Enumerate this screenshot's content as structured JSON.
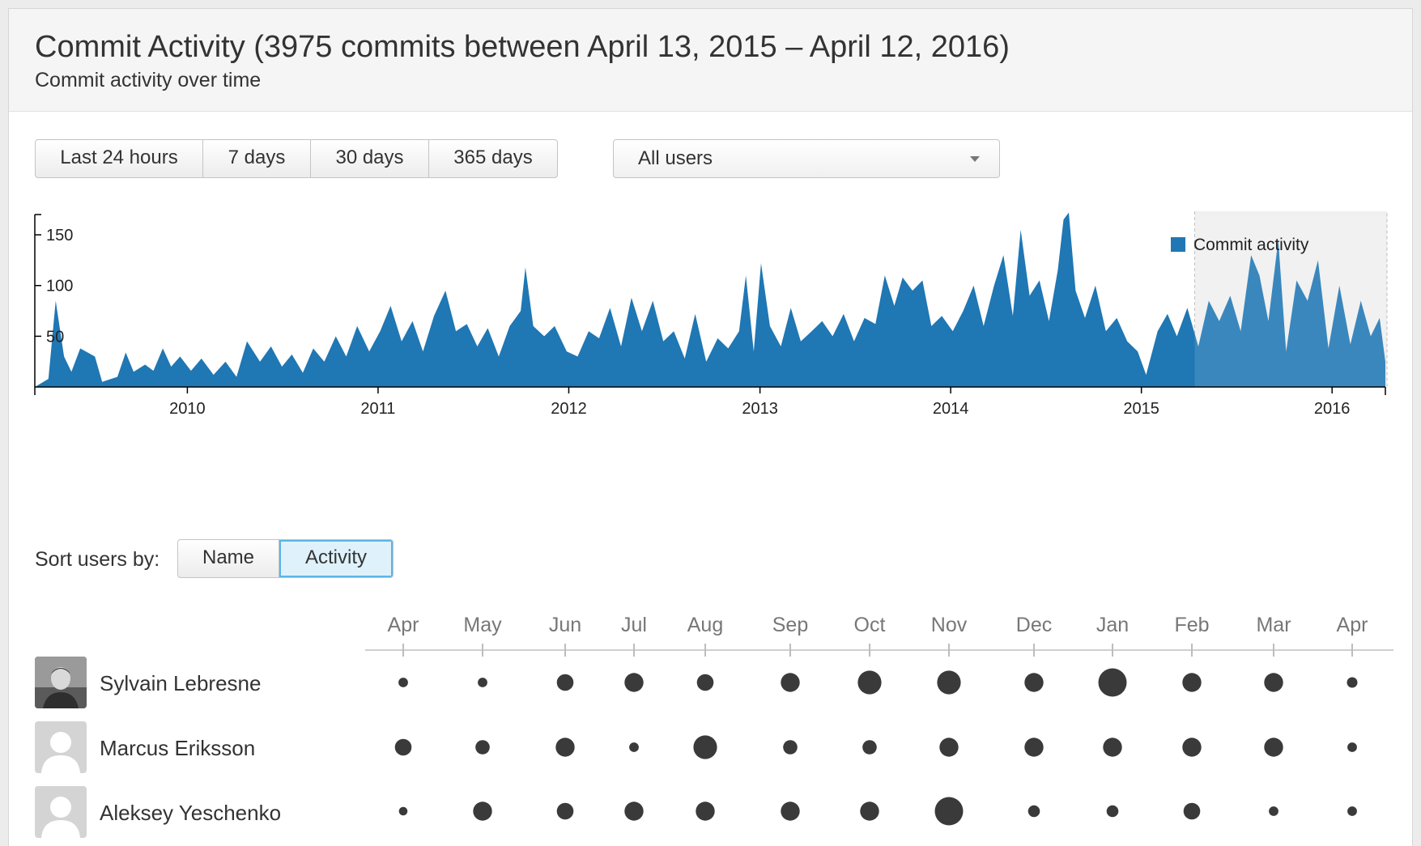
{
  "header": {
    "title": "Commit Activity (3975 commits between April 13, 2015 – April 12, 2016)",
    "subtitle": "Commit activity over time"
  },
  "range_buttons": [
    "Last 24 hours",
    "7 days",
    "30 days",
    "365 days"
  ],
  "user_filter": {
    "value": "All users"
  },
  "sort": {
    "label": "Sort users by:",
    "options": [
      "Name",
      "Activity"
    ],
    "active": "Activity"
  },
  "colors": {
    "series": "#1f77b4",
    "dot": "#3a3a3a",
    "selection": "#f0f0f0"
  },
  "chart_data": [
    {
      "type": "area",
      "title": "",
      "xlabel": "",
      "ylabel": "",
      "legend": {
        "label": "Commit activity",
        "position": "top-right"
      },
      "x_ticks": [
        "2010",
        "2011",
        "2012",
        "2013",
        "2014",
        "2015",
        "2016"
      ],
      "y_ticks": [
        50,
        100,
        150
      ],
      "xlim": [
        "2009-03-15",
        "2016-04-12"
      ],
      "ylim": [
        0,
        170
      ],
      "selection": [
        "2015-04-13",
        "2016-04-12"
      ],
      "series": [
        {
          "name": "Commit activity",
          "points": [
            [
              "2009-03-15",
              0
            ],
            [
              "2009-04-10",
              8
            ],
            [
              "2009-04-24",
              85
            ],
            [
              "2009-05-10",
              30
            ],
            [
              "2009-05-24",
              15
            ],
            [
              "2009-06-10",
              38
            ],
            [
              "2009-07-08",
              30
            ],
            [
              "2009-07-22",
              5
            ],
            [
              "2009-08-20",
              10
            ],
            [
              "2009-09-05",
              34
            ],
            [
              "2009-09-20",
              15
            ],
            [
              "2009-10-12",
              22
            ],
            [
              "2009-10-28",
              16
            ],
            [
              "2009-11-15",
              38
            ],
            [
              "2009-12-01",
              20
            ],
            [
              "2009-12-18",
              30
            ],
            [
              "2010-01-08",
              16
            ],
            [
              "2010-01-28",
              28
            ],
            [
              "2010-02-20",
              12
            ],
            [
              "2010-03-15",
              25
            ],
            [
              "2010-04-05",
              10
            ],
            [
              "2010-04-25",
              45
            ],
            [
              "2010-05-20",
              25
            ],
            [
              "2010-06-10",
              40
            ],
            [
              "2010-07-01",
              20
            ],
            [
              "2010-07-20",
              32
            ],
            [
              "2010-08-10",
              14
            ],
            [
              "2010-08-30",
              38
            ],
            [
              "2010-09-20",
              25
            ],
            [
              "2010-10-12",
              50
            ],
            [
              "2010-11-01",
              30
            ],
            [
              "2010-11-22",
              60
            ],
            [
              "2010-12-15",
              35
            ],
            [
              "2011-01-05",
              55
            ],
            [
              "2011-01-25",
              80
            ],
            [
              "2011-02-15",
              45
            ],
            [
              "2011-03-08",
              65
            ],
            [
              "2011-03-28",
              35
            ],
            [
              "2011-04-18",
              70
            ],
            [
              "2011-05-10",
              95
            ],
            [
              "2011-05-30",
              55
            ],
            [
              "2011-06-20",
              62
            ],
            [
              "2011-07-10",
              40
            ],
            [
              "2011-07-30",
              58
            ],
            [
              "2011-08-20",
              30
            ],
            [
              "2011-09-10",
              60
            ],
            [
              "2011-10-01",
              75
            ],
            [
              "2011-10-10",
              118
            ],
            [
              "2011-10-25",
              60
            ],
            [
              "2011-11-15",
              50
            ],
            [
              "2011-12-05",
              60
            ],
            [
              "2011-12-28",
              35
            ],
            [
              "2012-01-18",
              30
            ],
            [
              "2012-02-08",
              55
            ],
            [
              "2012-02-28",
              48
            ],
            [
              "2012-03-20",
              78
            ],
            [
              "2012-04-10",
              40
            ],
            [
              "2012-04-30",
              88
            ],
            [
              "2012-05-20",
              55
            ],
            [
              "2012-06-10",
              85
            ],
            [
              "2012-06-30",
              45
            ],
            [
              "2012-07-20",
              55
            ],
            [
              "2012-08-10",
              28
            ],
            [
              "2012-08-30",
              72
            ],
            [
              "2012-09-20",
              25
            ],
            [
              "2012-10-12",
              48
            ],
            [
              "2012-11-01",
              38
            ],
            [
              "2012-11-22",
              55
            ],
            [
              "2012-12-05",
              110
            ],
            [
              "2012-12-20",
              35
            ],
            [
              "2013-01-03",
              122
            ],
            [
              "2013-01-20",
              60
            ],
            [
              "2013-02-10",
              40
            ],
            [
              "2013-03-01",
              78
            ],
            [
              "2013-03-20",
              45
            ],
            [
              "2013-04-10",
              55
            ],
            [
              "2013-04-30",
              65
            ],
            [
              "2013-05-20",
              50
            ],
            [
              "2013-06-10",
              72
            ],
            [
              "2013-06-30",
              45
            ],
            [
              "2013-07-20",
              68
            ],
            [
              "2013-08-10",
              62
            ],
            [
              "2013-08-28",
              110
            ],
            [
              "2013-09-15",
              80
            ],
            [
              "2013-10-01",
              108
            ],
            [
              "2013-10-20",
              95
            ],
            [
              "2013-11-08",
              105
            ],
            [
              "2013-11-25",
              60
            ],
            [
              "2013-12-15",
              70
            ],
            [
              "2014-01-05",
              55
            ],
            [
              "2014-01-25",
              75
            ],
            [
              "2014-02-14",
              100
            ],
            [
              "2014-03-05",
              60
            ],
            [
              "2014-03-25",
              100
            ],
            [
              "2014-04-12",
              130
            ],
            [
              "2014-04-30",
              70
            ],
            [
              "2014-05-15",
              155
            ],
            [
              "2014-06-01",
              90
            ],
            [
              "2014-06-20",
              105
            ],
            [
              "2014-07-08",
              65
            ],
            [
              "2014-07-25",
              115
            ],
            [
              "2014-08-05",
              165
            ],
            [
              "2014-08-15",
              172
            ],
            [
              "2014-08-28",
              95
            ],
            [
              "2014-09-15",
              68
            ],
            [
              "2014-10-05",
              100
            ],
            [
              "2014-10-25",
              55
            ],
            [
              "2014-11-15",
              68
            ],
            [
              "2014-12-05",
              45
            ],
            [
              "2014-12-25",
              35
            ],
            [
              "2015-01-10",
              12
            ],
            [
              "2015-02-01",
              55
            ],
            [
              "2015-02-20",
              72
            ],
            [
              "2015-03-10",
              50
            ],
            [
              "2015-03-30",
              78
            ],
            [
              "2015-04-20",
              40
            ],
            [
              "2015-05-10",
              85
            ],
            [
              "2015-05-30",
              65
            ],
            [
              "2015-06-20",
              90
            ],
            [
              "2015-07-10",
              55
            ],
            [
              "2015-07-30",
              130
            ],
            [
              "2015-08-15",
              110
            ],
            [
              "2015-09-01",
              65
            ],
            [
              "2015-09-20",
              145
            ],
            [
              "2015-10-05",
              35
            ],
            [
              "2015-10-25",
              105
            ],
            [
              "2015-11-15",
              85
            ],
            [
              "2015-12-05",
              125
            ],
            [
              "2015-12-25",
              38
            ],
            [
              "2016-01-15",
              100
            ],
            [
              "2016-02-05",
              42
            ],
            [
              "2016-02-25",
              85
            ],
            [
              "2016-03-15",
              50
            ],
            [
              "2016-04-01",
              68
            ],
            [
              "2016-04-12",
              25
            ]
          ]
        }
      ]
    },
    {
      "type": "scatter",
      "title": "",
      "months": [
        "Apr",
        "May",
        "Jun",
        "Jul",
        "Aug",
        "Sep",
        "Oct",
        "Nov",
        "Dec",
        "Jan",
        "Feb",
        "Mar",
        "Apr"
      ],
      "note_size": "relative monthly commit activity per user (1-5 scale, read from dot size)",
      "series": [
        {
          "name": "Sylvain Lebresne",
          "values": [
            1,
            1,
            2.5,
            3,
            2.5,
            3,
            4,
            4,
            3,
            5,
            3,
            3,
            1.2
          ]
        },
        {
          "name": "Marcus Eriksson",
          "values": [
            2.5,
            2,
            3,
            1,
            4,
            2,
            2,
            3,
            3,
            3,
            3,
            3,
            1
          ]
        },
        {
          "name": "Aleksey Yeschenko",
          "values": [
            0.8,
            3,
            2.5,
            3,
            3,
            3,
            3,
            5,
            1.5,
            1.5,
            2.5,
            1,
            1
          ]
        }
      ]
    }
  ]
}
